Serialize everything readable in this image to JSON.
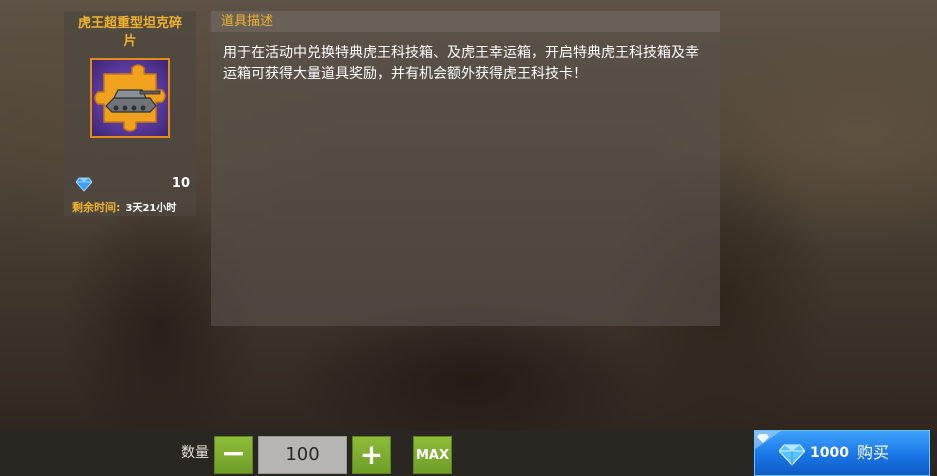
{
  "item": {
    "name": "虎王超重型坦克碎片",
    "icon": "tank-fragment-icon",
    "price": "10",
    "price_icon": "diamond-icon",
    "remaining_label": "剩余时间:",
    "remaining_value": "3天21小时"
  },
  "description": {
    "header": "道具描述",
    "text": "用于在活动中兑换特典虎王科技箱、及虎王幸运箱，开启特典虎王科技箱及幸运箱可获得大量道具奖励，并有机会额外获得虎王科技卡！"
  },
  "purchase": {
    "quantity_label": "数量",
    "minus_label": "−",
    "quantity_value": "100",
    "plus_label": "+",
    "max_label": "MAX",
    "total_price": "1000",
    "buy_label": "购买"
  },
  "colors": {
    "accent_gold": "#f2b22c",
    "button_green": "#7aac30",
    "buy_blue": "#1976e6"
  }
}
